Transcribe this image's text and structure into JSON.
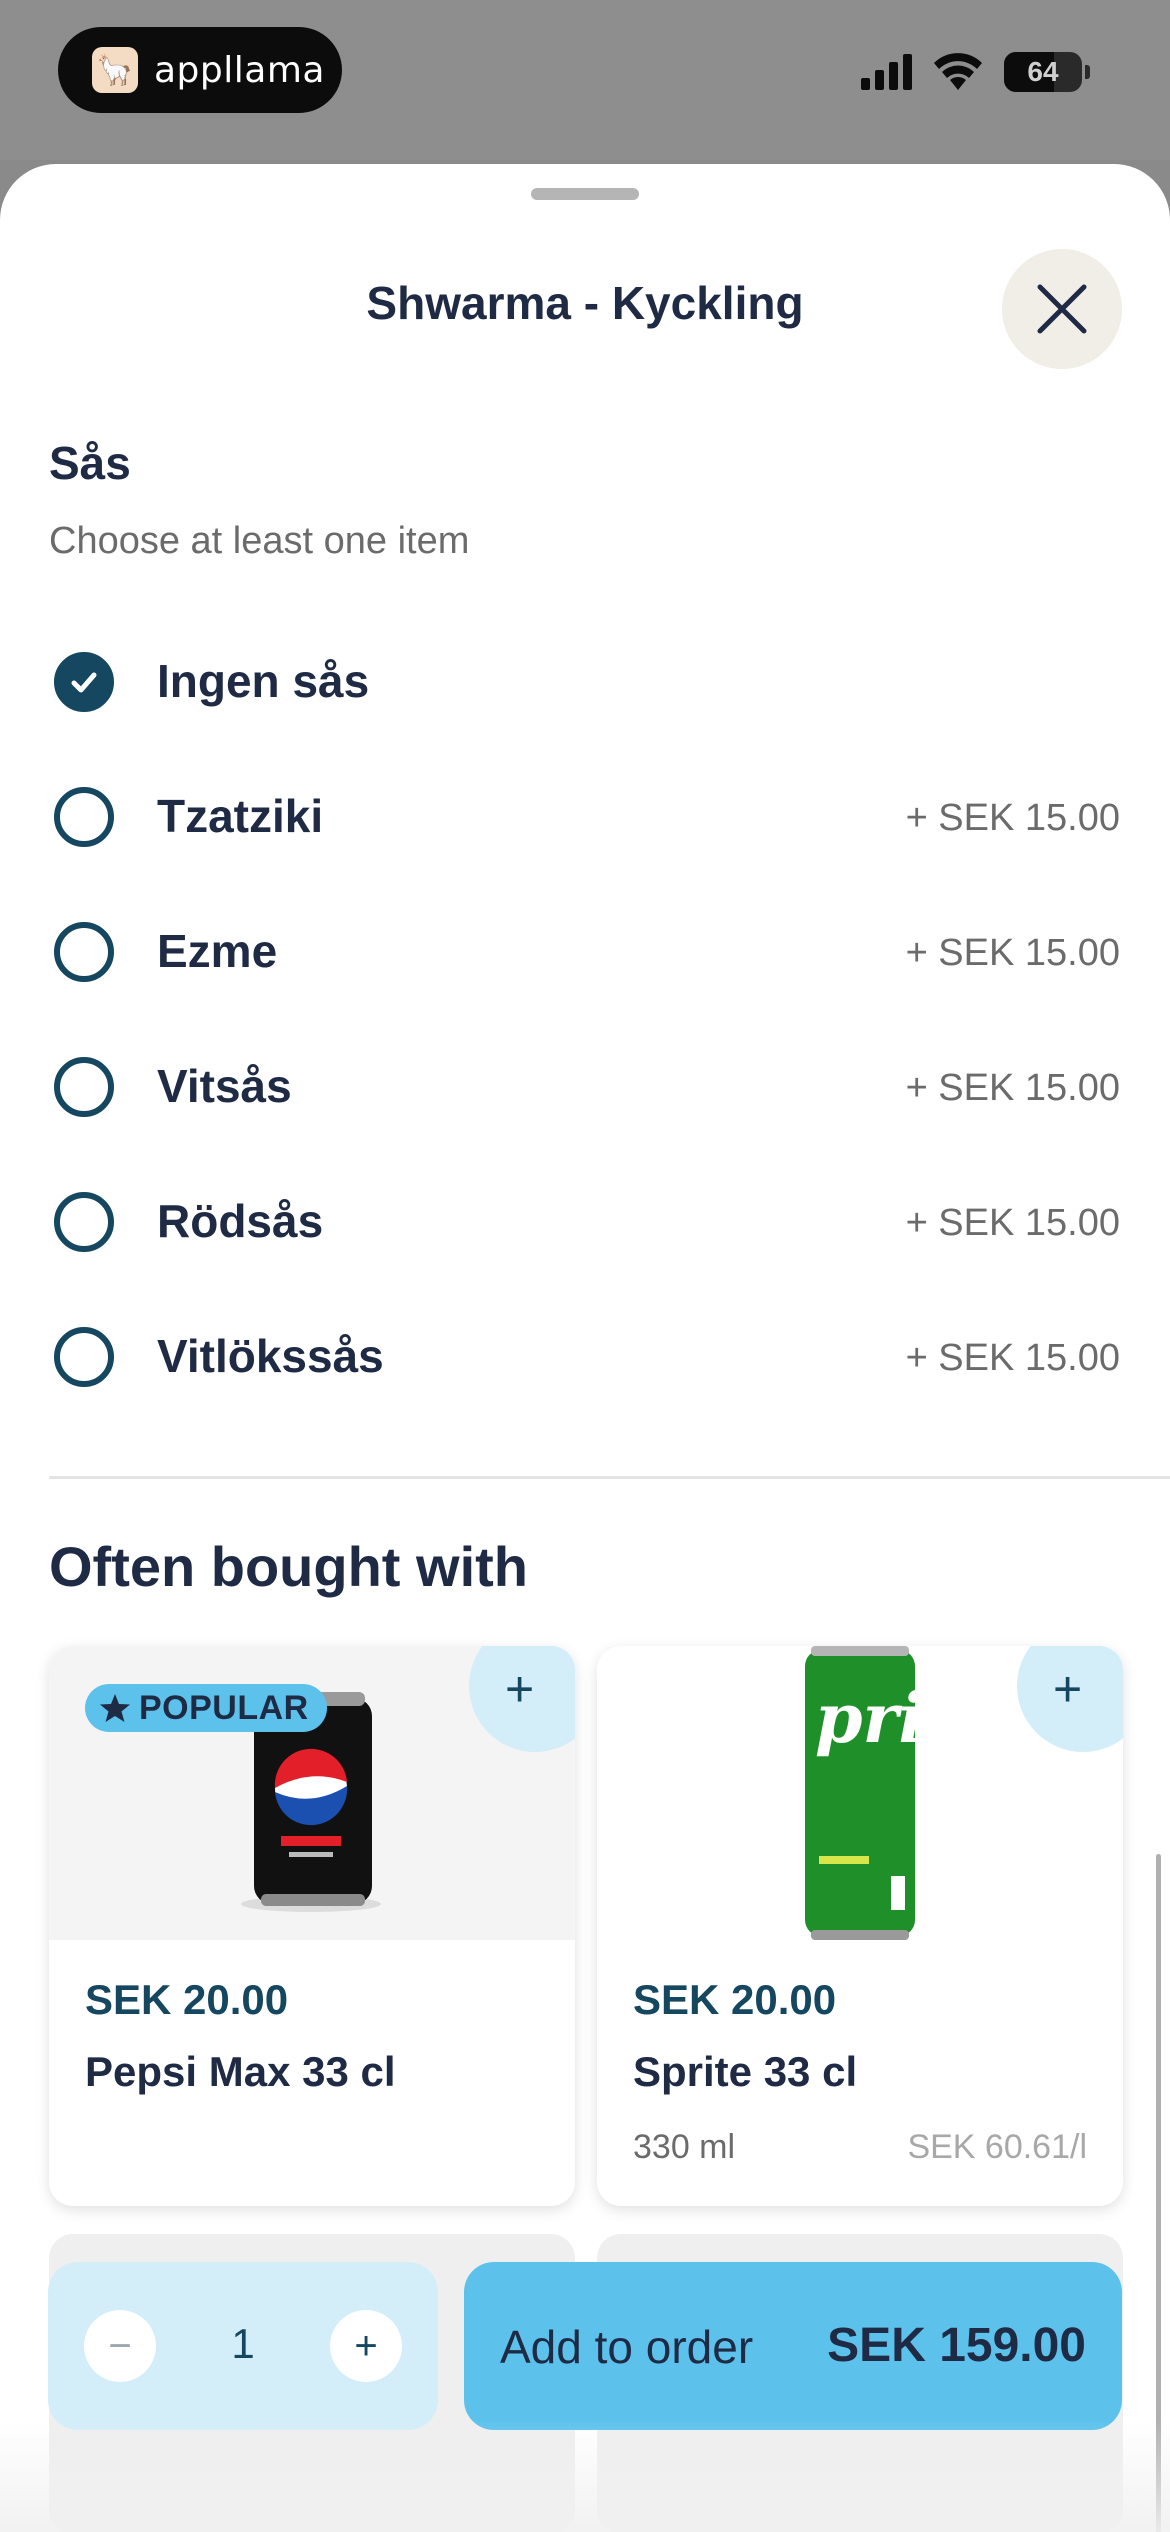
{
  "status_bar": {
    "app_name": "appllama",
    "battery": "64",
    "battery_level": 0.64
  },
  "sheet": {
    "title": "Shwarma - Kyckling"
  },
  "sauce_section": {
    "title": "Sås",
    "subtitle": "Choose at least one item",
    "options": [
      {
        "label": "Ingen sås",
        "price": "",
        "checked": true
      },
      {
        "label": "Tzatziki",
        "price": "+ SEK 15.00",
        "checked": false
      },
      {
        "label": "Ezme",
        "price": "+ SEK 15.00",
        "checked": false
      },
      {
        "label": "Vitsås",
        "price": "+ SEK 15.00",
        "checked": false
      },
      {
        "label": "Rödsås",
        "price": "+ SEK 15.00",
        "checked": false
      },
      {
        "label": "Vitlökssås",
        "price": "+ SEK 15.00",
        "checked": false
      }
    ]
  },
  "often_bought": {
    "title": "Often bought with",
    "items": [
      {
        "badge": "POPULAR",
        "price": "SEK 20.00",
        "name": "Pepsi Max 33 cl",
        "volume": "",
        "unit_price": ""
      },
      {
        "badge": "",
        "price": "SEK 20.00",
        "name": "Sprite 33 cl",
        "volume": "330 ml",
        "unit_price": "SEK 60.61/l"
      }
    ]
  },
  "bottom_bar": {
    "quantity": "1",
    "minus": "−",
    "plus": "+",
    "add_label": "Add to order",
    "total_price": "SEK 159.00"
  },
  "colors": {
    "accent": "#5cc2ec",
    "accent_light": "#d3eef9",
    "dark_teal": "#154760",
    "text": "#1f2b45"
  }
}
